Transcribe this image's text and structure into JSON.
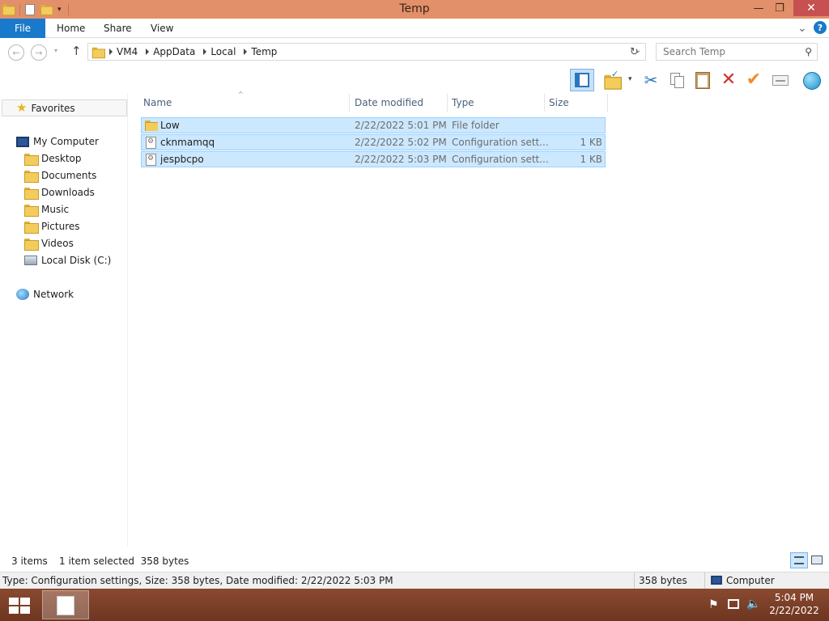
{
  "window": {
    "title": "Temp",
    "min_glyph": "—",
    "max_glyph": "❐",
    "close_glyph": "✕"
  },
  "ribbon": {
    "tabs": [
      "File",
      "Home",
      "Share",
      "View"
    ],
    "expand_glyph": "⌄",
    "help_glyph": "?"
  },
  "address": {
    "crumbs": [
      "VM4",
      "AppData",
      "Local",
      "Temp"
    ],
    "search_placeholder": "Search Temp"
  },
  "nav_pane": {
    "favorites": "Favorites",
    "computer": "My Computer",
    "computer_children": [
      "Desktop",
      "Documents",
      "Downloads",
      "Music",
      "Pictures",
      "Videos",
      "Local Disk (C:)"
    ],
    "network": "Network"
  },
  "columns": [
    "Name",
    "Date modified",
    "Type",
    "Size"
  ],
  "files": [
    {
      "name": "Low",
      "date": "2/22/2022 5:01 PM",
      "type": "File folder",
      "size": "",
      "icon": "folder-icon"
    },
    {
      "name": "cknmamqq",
      "date": "2/22/2022 5:02 PM",
      "type": "Configuration sett...",
      "size": "1 KB",
      "icon": "config-file-icon"
    },
    {
      "name": "jespbcpo",
      "date": "2/22/2022 5:03 PM",
      "type": "Configuration sett...",
      "size": "1 KB",
      "icon": "config-file-icon"
    }
  ],
  "status": {
    "items": "3 items",
    "selected": "1 item selected  358 bytes"
  },
  "details": {
    "text": "Type: Configuration settings, Size: 358 bytes, Date modified: 2/22/2022 5:03 PM",
    "size": "358 bytes",
    "location": "Computer"
  },
  "taskbar": {
    "time": "5:04 PM",
    "date": "2/22/2022"
  },
  "colors": {
    "titlebar": "#e2906a",
    "accent": "#1979ca",
    "selection": "#cce8ff",
    "taskbar": "#7a3d26"
  }
}
